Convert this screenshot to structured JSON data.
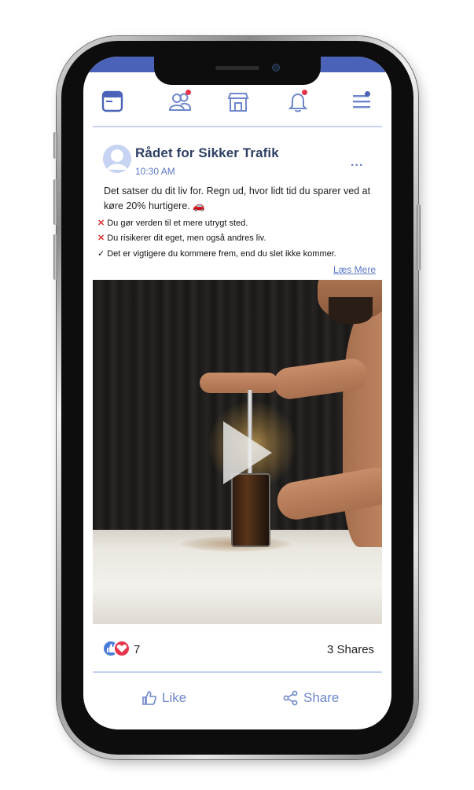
{
  "nav": {
    "items": [
      {
        "name": "news-feed-icon",
        "badge": false
      },
      {
        "name": "friends-icon",
        "badge": true
      },
      {
        "name": "marketplace-icon",
        "badge": false
      },
      {
        "name": "notifications-icon",
        "badge": true
      },
      {
        "name": "menu-icon",
        "badge": true
      }
    ],
    "accent_color": "#4a63b8",
    "badge_color": "#e8334a"
  },
  "post": {
    "author": "Rådet for Sikker Trafik",
    "time": "10:30 AM",
    "more_label": "...",
    "caption": "Det satser du dit liv for. Regn ud, hvor lidt tid du sparer ved at køre 20% hurtigere. 🚗",
    "bullets": [
      {
        "mark": "✕",
        "text": "Du gør verden til et mere utrygt sted."
      },
      {
        "mark": "✕",
        "text": "Du risikerer dit eget, men også andres liv."
      },
      {
        "mark": "✓",
        "text": "Det er vigtigere du kommere frem, end du slet ikke kommer."
      }
    ],
    "read_more": "Læs Mere",
    "video": {
      "play_icon": "play-icon"
    },
    "reactions": {
      "count": "7",
      "icons": [
        "like-icon",
        "love-icon"
      ]
    },
    "shares": "3 Shares",
    "actions": {
      "like": "Like",
      "share": "Share"
    }
  }
}
